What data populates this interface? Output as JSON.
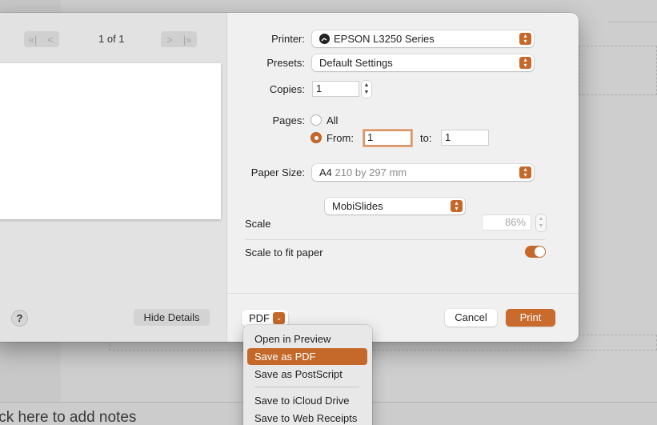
{
  "preview": {
    "page_count": "1 of 1",
    "nav_first": "«|",
    "nav_prev": "<",
    "nav_next": ">",
    "nav_last": "|»",
    "help_label": "?",
    "hide_details_label": "Hide Details"
  },
  "settings": {
    "printer_label": "Printer:",
    "printer_value": "EPSON L3250 Series",
    "presets_label": "Presets:",
    "presets_value": "Default Settings",
    "copies_label": "Copies:",
    "copies_value": "1",
    "pages_label": "Pages:",
    "pages_all_label": "All",
    "pages_from_label": "From:",
    "pages_from_value": "1",
    "pages_to_label": "to:",
    "pages_to_value": "1",
    "paper_size_label": "Paper Size:",
    "paper_size_value": "A4",
    "paper_size_detail": "210 by 297 mm",
    "app_section_value": "MobiSlides",
    "scale_label": "Scale",
    "scale_value": "86%",
    "scale_to_fit_label": "Scale to fit paper",
    "scale_to_fit_on": true
  },
  "footer": {
    "pdf_label": "PDF",
    "cancel_label": "Cancel",
    "print_label": "Print"
  },
  "pdf_menu": {
    "items": [
      {
        "label": "Open in Preview",
        "selected": false
      },
      {
        "label": "Save as PDF",
        "selected": true
      },
      {
        "label": "Save as PostScript",
        "selected": false
      },
      {
        "label": "Save to iCloud Drive",
        "selected": false
      },
      {
        "label": "Save to Web Receipts",
        "selected": false
      }
    ]
  },
  "background": {
    "notes_placeholder": "ick here to add notes"
  },
  "colors": {
    "accent": "#c5692a",
    "dialog_bg": "#f1f0f1"
  },
  "icons": {
    "printer_status": "printer-status-icon",
    "popup_chevrons": "up-down-chevron-icon"
  }
}
